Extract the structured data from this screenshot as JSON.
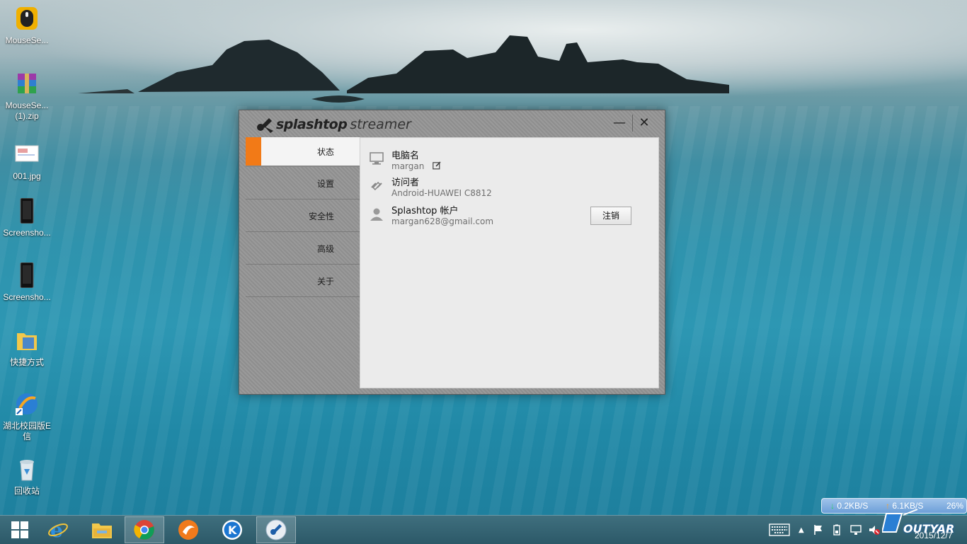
{
  "desktop": {
    "icons": [
      {
        "label": "MouseSe..."
      },
      {
        "label": "MouseSe...",
        "label2": "(1).zip"
      },
      {
        "label": "001.jpg"
      },
      {
        "label": "Screensho..."
      },
      {
        "label": "Screensho..."
      },
      {
        "label": "快捷方式"
      },
      {
        "label": "湖北校园版E",
        "label2": "信"
      },
      {
        "label": "回收站"
      }
    ]
  },
  "window": {
    "brand": "splashtop",
    "product": "streamer",
    "minimize_label": "—",
    "close_label": "✕",
    "nav": [
      {
        "label": "状态"
      },
      {
        "label": "设置"
      },
      {
        "label": "安全性"
      },
      {
        "label": "高级"
      },
      {
        "label": "关于"
      }
    ],
    "status": {
      "computer_name_title": "电脑名",
      "computer_name_value": "margan",
      "visitor_title": "访问者",
      "visitor_value": "Android-HUAWEI C8812",
      "account_title": "Splashtop 帐户",
      "account_value": "margan628@gmail.com",
      "logout_label": "注销"
    }
  },
  "tray": {
    "download_speed": "0.2KB/S",
    "upload_speed": "6.1KB/S",
    "percent": "26%",
    "clock": "2015/12/7",
    "watermark": "OUTYAR"
  },
  "colors": {
    "accent": "#f27a17",
    "window_bg": "#949494",
    "content_bg": "#ebebeb"
  }
}
